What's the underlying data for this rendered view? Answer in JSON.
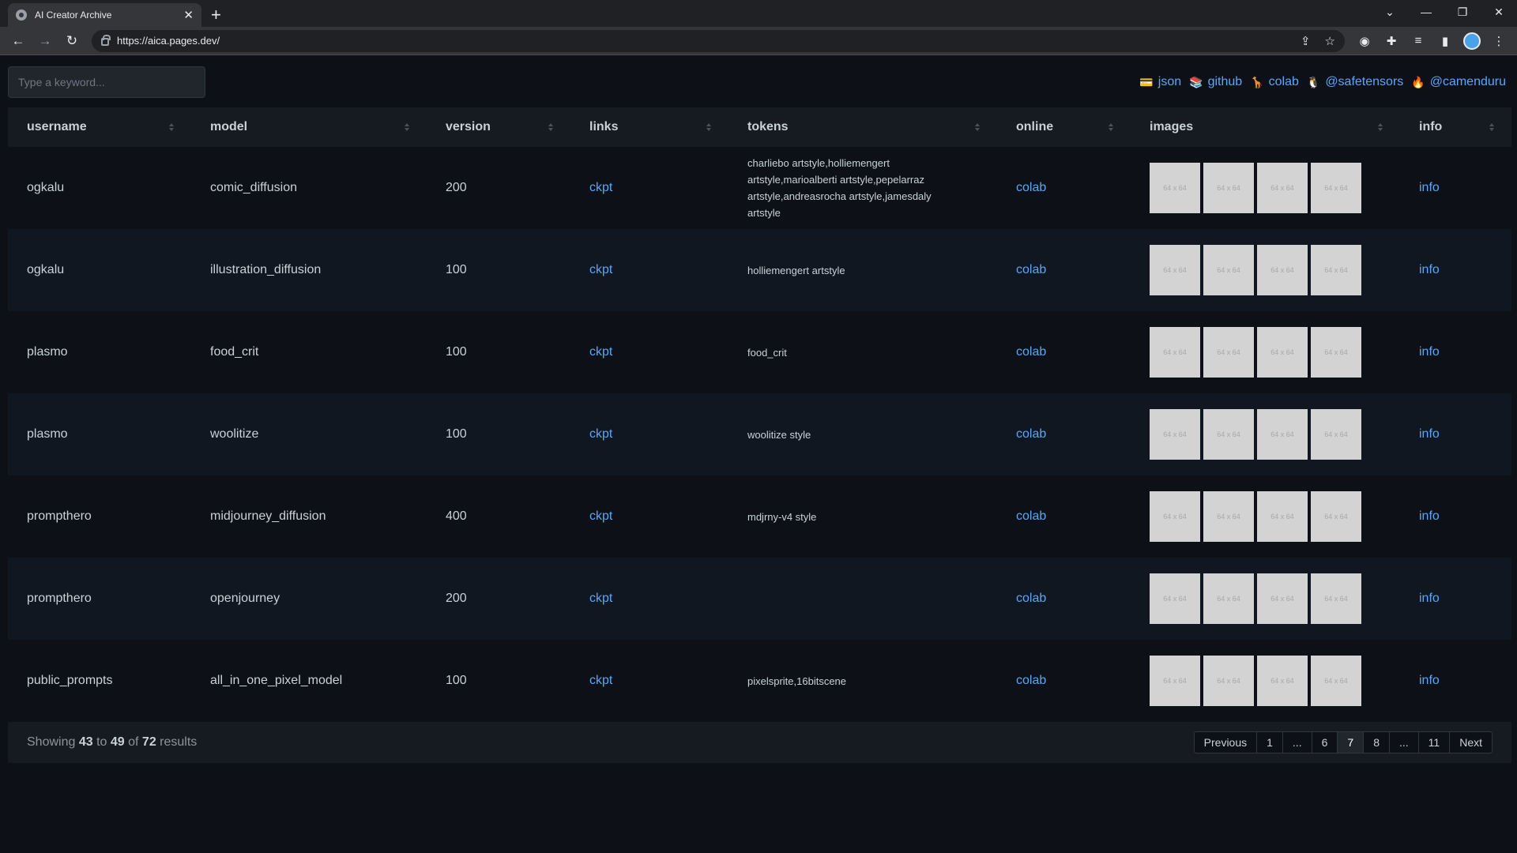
{
  "browser": {
    "tab_title": "AI Creator Archive",
    "url": "https://aica.pages.dev/"
  },
  "search": {
    "placeholder": "Type a keyword..."
  },
  "toplinks": [
    {
      "emoji": "💳",
      "label": "json"
    },
    {
      "emoji": "📚",
      "label": "github"
    },
    {
      "emoji": "🦒",
      "label": "colab"
    },
    {
      "emoji": "🐧",
      "label": "@safetensors"
    },
    {
      "emoji": "🔥",
      "label": "@camenduru"
    }
  ],
  "table": {
    "headers": [
      "username",
      "model",
      "version",
      "links",
      "tokens",
      "online",
      "images",
      "info"
    ],
    "thumb_label": "64 x 64",
    "rows": [
      {
        "username": "ogkalu",
        "model": "comic_diffusion",
        "version": "200",
        "links": "ckpt",
        "tokens": "charliebo artstyle,holliemengert artstyle,marioalberti artstyle,pepelarraz artstyle,andreasrocha artstyle,jamesdaly artstyle",
        "online": "colab",
        "info": "info"
      },
      {
        "username": "ogkalu",
        "model": "illustration_diffusion",
        "version": "100",
        "links": "ckpt",
        "tokens": "holliemengert artstyle",
        "online": "colab",
        "info": "info"
      },
      {
        "username": "plasmo",
        "model": "food_crit",
        "version": "100",
        "links": "ckpt",
        "tokens": "food_crit",
        "online": "colab",
        "info": "info"
      },
      {
        "username": "plasmo",
        "model": "woolitize",
        "version": "100",
        "links": "ckpt",
        "tokens": "woolitize style",
        "online": "colab",
        "info": "info"
      },
      {
        "username": "prompthero",
        "model": "midjourney_diffusion",
        "version": "400",
        "links": "ckpt",
        "tokens": "mdjrny-v4 style",
        "online": "colab",
        "info": "info"
      },
      {
        "username": "prompthero",
        "model": "openjourney",
        "version": "200",
        "links": "ckpt",
        "tokens": "",
        "online": "colab",
        "info": "info"
      },
      {
        "username": "public_prompts",
        "model": "all_in_one_pixel_model",
        "version": "100",
        "links": "ckpt",
        "tokens": "pixelsprite,16bitscene",
        "online": "colab",
        "info": "info"
      }
    ]
  },
  "footer": {
    "showing_prefix": "Showing",
    "from": "43",
    "to_word": "to",
    "to": "49",
    "of_word": "of",
    "total": "72",
    "suffix": "results"
  },
  "pagination": {
    "previous": "Previous",
    "pages": [
      "1",
      "...",
      "6",
      "7",
      "8",
      "...",
      "11"
    ],
    "active": "7",
    "next": "Next"
  }
}
